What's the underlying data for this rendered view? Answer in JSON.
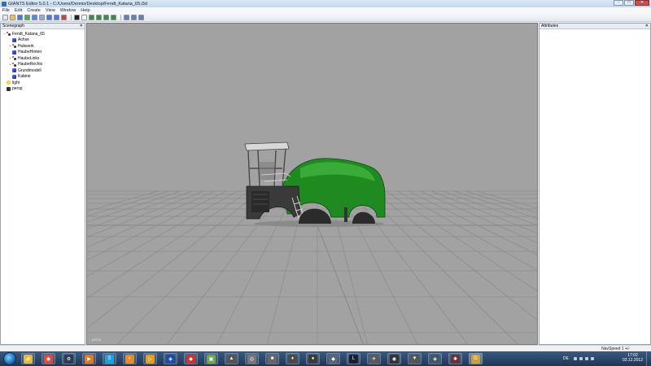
{
  "window": {
    "title": "GIANTS Editor 5.0.1 - C:/Users/Dennis/Desktop/Fendt_Katana_65.i3d",
    "controls": [
      "-",
      "□",
      "✕"
    ]
  },
  "menu": [
    "File",
    "Edit",
    "Create",
    "View",
    "Window",
    "Help"
  ],
  "toolbar": {
    "buttons": [
      {
        "icon": "new-file-icon",
        "color": "#e8e8e8"
      },
      {
        "icon": "open-folder-icon",
        "color": "#e8c25a"
      },
      {
        "icon": "save-icon",
        "color": "#5577cc"
      },
      {
        "icon": "import-icon",
        "color": "#55aa55"
      },
      {
        "icon": "export-icon",
        "color": "#5588cc"
      },
      {
        "icon": "copy-icon",
        "color": "#99aacc"
      },
      {
        "icon": "undo-icon",
        "color": "#4c7bd1"
      },
      {
        "icon": "redo-icon",
        "color": "#4c7bd1"
      },
      {
        "icon": "delete-icon",
        "color": "#cc4444"
      },
      {
        "icon": "play-icon",
        "color": "#222222"
      },
      {
        "icon": "select-tool-icon",
        "color": "#ffffff"
      },
      {
        "icon": "move-tool-icon",
        "color": "#3a8d3a"
      },
      {
        "icon": "rotate-tool-icon",
        "color": "#3a8d3a"
      },
      {
        "icon": "scale-tool-icon",
        "color": "#3a8d3a"
      },
      {
        "icon": "terrain-tool-icon",
        "color": "#3a8d3a"
      },
      {
        "icon": "paint-tool-icon",
        "color": "#6a7fae"
      },
      {
        "icon": "camera-tool-icon",
        "color": "#6a7fae"
      },
      {
        "icon": "grid-tool-icon",
        "color": "#6a7fae"
      }
    ]
  },
  "scenegraph": {
    "title": "Scenegraph",
    "close": "✕",
    "items": [
      {
        "label": "Fendt_Katana_65",
        "icon": "transform-icon",
        "depth": 0,
        "toggle": "−"
      },
      {
        "label": "Achse",
        "icon": "mesh-icon",
        "depth": 1,
        "toggle": ""
      },
      {
        "label": "Hubwerk",
        "icon": "transform-icon",
        "depth": 1,
        "toggle": "+"
      },
      {
        "label": "HaubeHinten",
        "icon": "mesh-icon",
        "depth": 1,
        "toggle": ""
      },
      {
        "label": "HaubeLinks",
        "icon": "transform-icon",
        "depth": 1,
        "toggle": "+"
      },
      {
        "label": "HaubeRechts",
        "icon": "transform-icon",
        "depth": 1,
        "toggle": "+"
      },
      {
        "label": "Grundmodell",
        "icon": "mesh-icon",
        "depth": 1,
        "toggle": ""
      },
      {
        "label": "Kabine",
        "icon": "mesh-icon",
        "depth": 1,
        "toggle": ""
      },
      {
        "label": "light",
        "icon": "light-icon",
        "depth": 0,
        "toggle": ""
      },
      {
        "label": "persp",
        "icon": "camera-icon",
        "depth": 0,
        "toggle": ""
      }
    ]
  },
  "attributes": {
    "title": "Attributes",
    "close": "✕"
  },
  "viewport": {
    "camera_label": "persp",
    "background": "#a2a2a2",
    "grid_color": "#8b8b8b",
    "model_body_color": "#1f8a1f",
    "model_frame_color": "#3a3a3a"
  },
  "statusbar": {
    "navspeed": "NavSpeed 1 +/-"
  },
  "taskbar": {
    "apps": [
      {
        "name": "windows-explorer-icon",
        "glyph": "📁",
        "color": "#e1b84a"
      },
      {
        "name": "chrome-icon",
        "glyph": "◉",
        "color": "#d94b3a"
      },
      {
        "name": "steam-icon",
        "glyph": "⚙",
        "color": "#2a3b52"
      },
      {
        "name": "media-player-icon",
        "glyph": "▶",
        "color": "#e07a1e"
      },
      {
        "name": "skype-icon",
        "glyph": "S",
        "color": "#1fa0e0"
      },
      {
        "name": "blender-icon",
        "glyph": "◐",
        "color": "#e88b2a"
      },
      {
        "name": "video-player-icon",
        "glyph": "▷",
        "color": "#e0a01e"
      },
      {
        "name": "cinema4d-icon",
        "glyph": "◈",
        "color": "#1b4da3"
      },
      {
        "name": "sketchup-icon",
        "glyph": "◆",
        "color": "#cc3333"
      },
      {
        "name": "paint-icon",
        "glyph": "▣",
        "color": "#6aa84f"
      },
      {
        "name": "game1-icon",
        "glyph": "▲",
        "color": "#555555"
      },
      {
        "name": "game2-icon",
        "glyph": "◎",
        "color": "#777777"
      },
      {
        "name": "game3-icon",
        "glyph": "■",
        "color": "#666666"
      },
      {
        "name": "game4-icon",
        "glyph": "♦",
        "color": "#4a4a4a"
      },
      {
        "name": "game5-icon",
        "glyph": "●",
        "color": "#3a3a3a"
      },
      {
        "name": "game6-icon",
        "glyph": "◆",
        "color": "#556677"
      },
      {
        "name": "game7-icon",
        "glyph": "L",
        "color": "#1a2030"
      },
      {
        "name": "game8-icon",
        "glyph": "✈",
        "color": "#5a5a5a"
      },
      {
        "name": "game9-icon",
        "glyph": "◉",
        "color": "#333333"
      },
      {
        "name": "game10-icon",
        "glyph": "▼",
        "color": "#555555"
      },
      {
        "name": "game11-icon",
        "glyph": "◈",
        "color": "#445566"
      },
      {
        "name": "game12-icon",
        "glyph": "✱",
        "color": "#663333"
      },
      {
        "name": "giants-editor-icon",
        "glyph": "G",
        "color": "#c9a23a"
      }
    ],
    "tray": {
      "language": "DE",
      "time": "17:02",
      "date": "03.12.2012"
    }
  }
}
